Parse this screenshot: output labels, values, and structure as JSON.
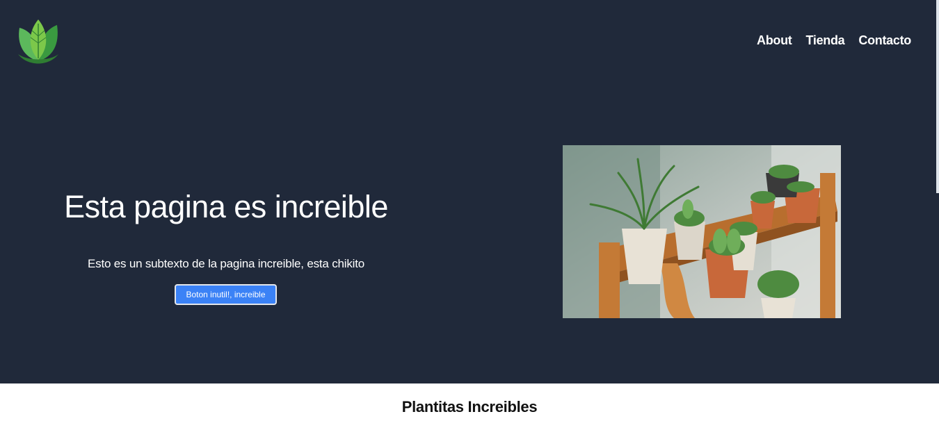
{
  "nav": {
    "items": [
      "About",
      "Tienda",
      "Contacto"
    ]
  },
  "hero": {
    "headline": "Esta pagina es increible",
    "subtext": "Esto es un subtexto de la pagina increible, esta chikito",
    "button_label": "Boton inutil!, increible"
  },
  "section": {
    "title": "Plantitas Increibles"
  },
  "colors": {
    "hero_background": "#20293a",
    "button": "#3b82f6",
    "text_light": "#ffffff",
    "text_dark": "#111111",
    "logo_green": "#4caf50"
  },
  "icons": {
    "logo": "leaf-logo-icon"
  }
}
